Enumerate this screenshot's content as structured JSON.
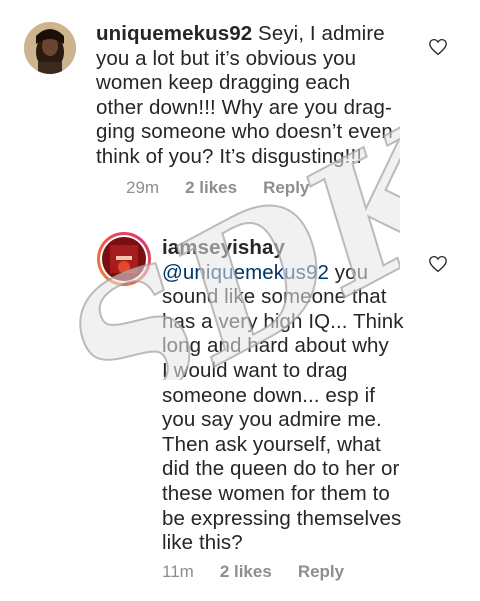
{
  "comments": [
    {
      "username": "uniquemekus92",
      "text": " Seyi, I admire you a lot but it’s obvious you women keep dragging each other down!!! Why are you drag-ging someone who doesn’t even think of you? It’s disgusting!!!",
      "lines": [
        "Seyi, I admire",
        "you a lot but it’s obvious you",
        "women keep dragging each",
        "other down!!! Why are you drag-",
        "ging someone who doesn’t even",
        "think of you? It’s disgusting!!!"
      ],
      "time": "29m",
      "likes": "2 likes",
      "reply": "Reply",
      "avatar_icon": "profile-photo",
      "like_icon": "heart-outline-icon"
    },
    {
      "username": "iamseyishay",
      "mention": "@uniquemekus92",
      "lines": [
        " you",
        "sound like someone that",
        "has a very high IQ... Think",
        "long and hard about why",
        "I would want to drag",
        "someone down... esp if",
        "you say you admire me.",
        "Then ask yourself,  what",
        "did the queen do to her or",
        "these women for them to",
        "be expressing themselves",
        "like this?"
      ],
      "time": "11m",
      "likes": "2 likes",
      "reply": "Reply",
      "avatar_icon": "profile-photo-story-ring",
      "like_icon": "heart-outline-icon"
    }
  ],
  "watermark": "SDK",
  "colors": {
    "text": "#262626",
    "meta": "#8e8e8e",
    "mention": "#003569",
    "story_ring_start": "#f58529",
    "story_ring_end": "#dd2a7b"
  }
}
